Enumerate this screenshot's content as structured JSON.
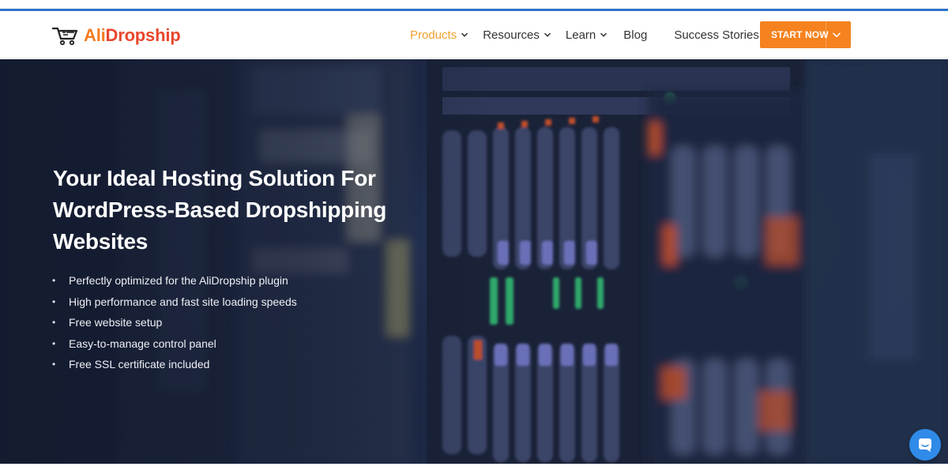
{
  "header": {
    "logo": {
      "part1": "Ali",
      "part2": "Dropship",
      "icon": "cart-icon"
    },
    "nav": [
      {
        "label": "Products",
        "has_dropdown": true,
        "active": true
      },
      {
        "label": "Resources",
        "has_dropdown": true,
        "active": false
      },
      {
        "label": "Learn",
        "has_dropdown": true,
        "active": false
      },
      {
        "label": "Blog",
        "has_dropdown": false,
        "active": false
      },
      {
        "label": "Success Stories",
        "has_dropdown": false,
        "active": false
      }
    ],
    "cta": {
      "label": "START NOW",
      "icon": "chevron-down-icon"
    }
  },
  "hero": {
    "title": "Your Ideal Hosting Solution For WordPress-Based Dropshipping Websites",
    "bullets": [
      "Perfectly optimized for the AliDropship plugin",
      "High performance and fast site loading speeds",
      "Free website setup",
      "Easy-to-manage control panel",
      "Free SSL certificate included"
    ],
    "background": "server-rack-image"
  },
  "chat": {
    "icon": "chat-icon"
  },
  "colors": {
    "accent": "#f5821f",
    "nav_active": "#f0a030",
    "top_line": "#2f72c9",
    "logo_red": "#e8472c",
    "chat": "#2f8ae8"
  }
}
